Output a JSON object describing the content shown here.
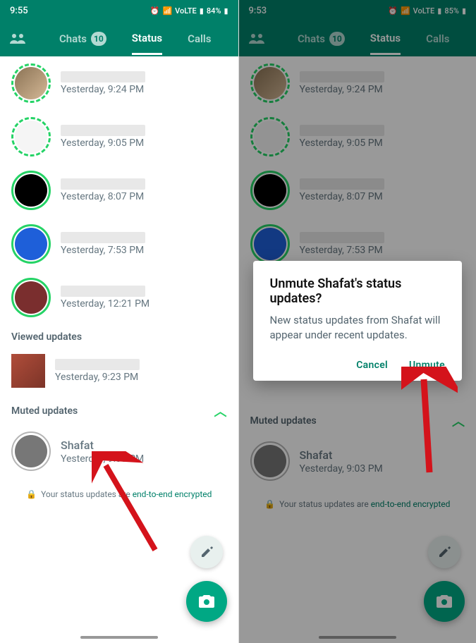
{
  "colors": {
    "primary": "#008069",
    "accent": "#25d366",
    "fab": "#00a884"
  },
  "left": {
    "statusbar": {
      "time": "9:55",
      "battery": "84%",
      "network": "VoLTE"
    },
    "tabs": {
      "chats": "Chats",
      "chats_badge": "10",
      "status": "Status",
      "calls": "Calls"
    },
    "statuses": [
      {
        "time": "Yesterday, 9:24 PM",
        "ring": "dashed",
        "img": "brown"
      },
      {
        "time": "Yesterday, 9:05 PM",
        "ring": "dashed",
        "img": "text"
      },
      {
        "time": "Yesterday, 8:07 PM",
        "ring": "unseen",
        "img": "black"
      },
      {
        "time": "Yesterday, 7:53 PM",
        "ring": "unseen",
        "img": "blue"
      },
      {
        "time": "Yesterday, 12:21 PM",
        "ring": "unseen",
        "img": "maroon"
      }
    ],
    "viewed_header": "Viewed updates",
    "viewed": [
      {
        "time": "Yesterday, 9:23 PM"
      }
    ],
    "muted_header": "Muted updates",
    "muted": [
      {
        "name": "Shafat",
        "time": "Yesterday, 9:03 PM"
      }
    ],
    "encryption": {
      "prefix": "Your status updates are",
      "link": "end-to-end encrypted"
    }
  },
  "right": {
    "statusbar": {
      "time": "9:53",
      "battery": "85%",
      "network": "VoLTE"
    },
    "tabs": {
      "chats": "Chats",
      "chats_badge": "10",
      "status": "Status",
      "calls": "Calls"
    },
    "statuses": [
      {
        "time": "Yesterday, 9:24 PM",
        "ring": "dashed",
        "img": "brown"
      },
      {
        "time": "Yesterday, 9:05 PM",
        "ring": "dashed",
        "img": "text"
      },
      {
        "time": "Yesterday, 8:07 PM",
        "ring": "unseen",
        "img": "black"
      },
      {
        "time": "Yesterday, 7:53 PM",
        "ring": "unseen",
        "img": "blue"
      }
    ],
    "muted_header": "Muted updates",
    "muted": [
      {
        "name": "Shafat",
        "time": "Yesterday, 9:03 PM"
      }
    ],
    "encryption": {
      "prefix": "Your status updates are",
      "link": "end-to-end encrypted"
    },
    "dialog": {
      "title": "Unmute Shafat's status updates?",
      "text": "New status updates from Shafat will appear under recent updates.",
      "cancel": "Cancel",
      "confirm": "Unmute"
    }
  }
}
